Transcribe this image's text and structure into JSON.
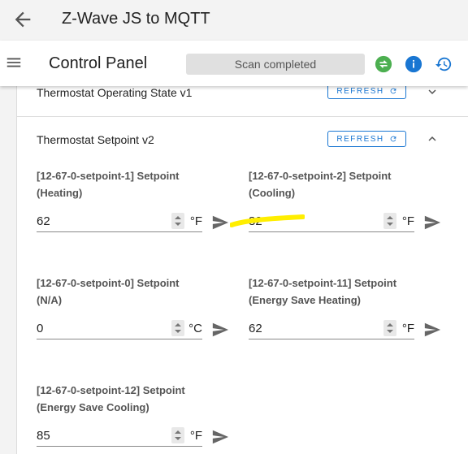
{
  "header": {
    "app_title": "Z-Wave JS to MQTT"
  },
  "toolbar": {
    "page_title": "Control Panel",
    "scan_status": "Scan completed"
  },
  "sections": [
    {
      "title": "Thermostat Operating State v1",
      "refresh_label": "REFRESH"
    },
    {
      "title": "Thermostat Setpoint v2",
      "refresh_label": "REFRESH"
    }
  ],
  "setpoints": [
    {
      "label_line1": "[12-67-0-setpoint-1] Setpoint",
      "label_line2": "(Heating)",
      "value": "62",
      "unit": "°F"
    },
    {
      "label_line1": "[12-67-0-setpoint-2] Setpoint",
      "label_line2": "(Cooling)",
      "value": "82",
      "unit": "°F"
    },
    {
      "label_line1": "[12-67-0-setpoint-0] Setpoint",
      "label_line2": "(N/A)",
      "value": "0",
      "unit": "°C"
    },
    {
      "label_line1": "[12-67-0-setpoint-11] Setpoint",
      "label_line2": "(Energy Save Heating)",
      "value": "62",
      "unit": "°F"
    },
    {
      "label_line1": "[12-67-0-setpoint-12] Setpoint",
      "label_line2": "(Energy Save Cooling)",
      "value": "85",
      "unit": "°F"
    }
  ],
  "colors": {
    "accent": "#1976d2",
    "green": "#4caf50",
    "highlight": "#ffee00"
  }
}
